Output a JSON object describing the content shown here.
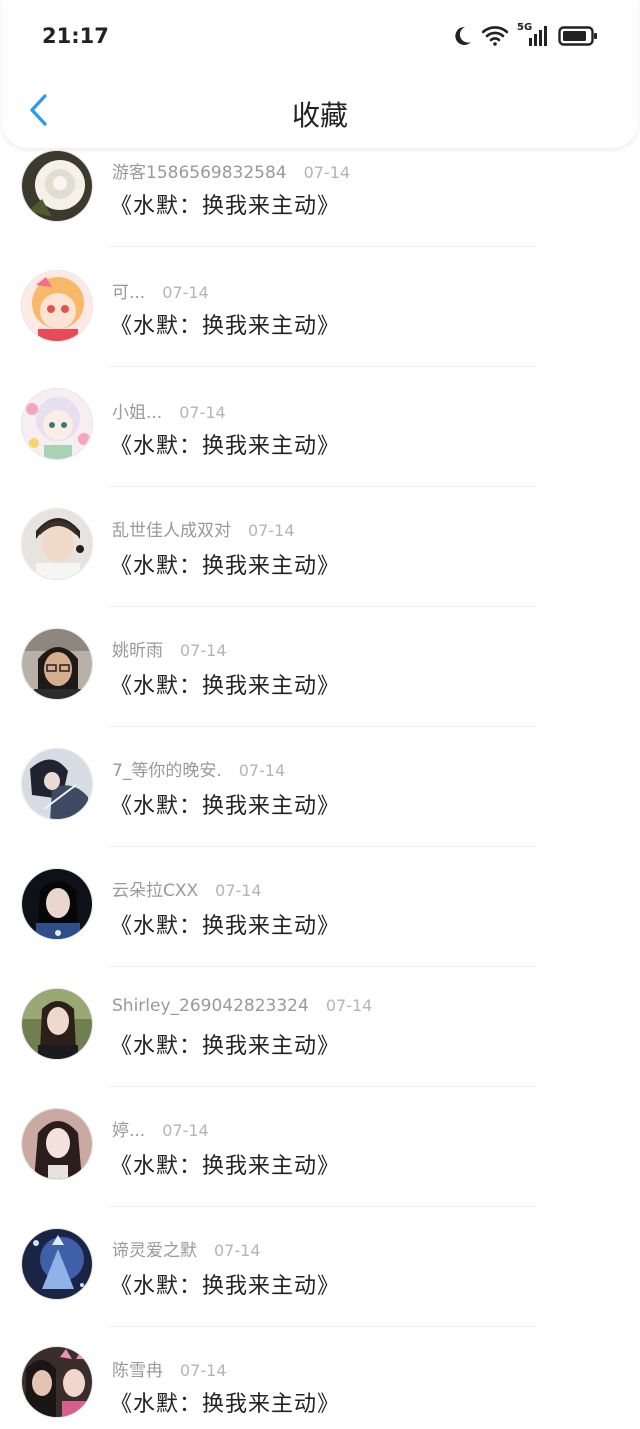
{
  "status_bar": {
    "time": "21:17",
    "icons": [
      "moon-icon",
      "wifi-icon",
      "5g-signal-icon",
      "battery-icon"
    ],
    "network_label": "5G"
  },
  "nav": {
    "back_icon": "chevron-left-icon",
    "title": "收藏",
    "accent_color": "#2f9bf0"
  },
  "favorites": [
    {
      "nickname": "游客1586569832584",
      "date": "07-14",
      "title": "《水默：换我来主动》",
      "avatar": "white-rose"
    },
    {
      "nickname": "可...",
      "date": "07-14",
      "title": "《水默：换我来主动》",
      "avatar": "anime-girl-pink"
    },
    {
      "nickname": "小姐...",
      "date": "07-14",
      "title": "《水默：换我来主动》",
      "avatar": "doll-girl-flowers"
    },
    {
      "nickname": "乱世佳人成双对",
      "date": "07-14",
      "title": "《水默：换我来主动》",
      "avatar": "young-man"
    },
    {
      "nickname": "姚昕雨",
      "date": "07-14",
      "title": "《水默：换我来主动》",
      "avatar": "girl-glasses"
    },
    {
      "nickname": "7_等你的晚安.",
      "date": "07-14",
      "title": "《水默：换我来主动》",
      "avatar": "embracing-couple"
    },
    {
      "nickname": "云朵拉CXX",
      "date": "07-14",
      "title": "《水默：换我来主动》",
      "avatar": "girl-dark"
    },
    {
      "nickname": "Shirley_269042823324",
      "date": "07-14",
      "title": "《水默：换我来主动》",
      "avatar": "girl-outdoor"
    },
    {
      "nickname": "婷...",
      "date": "07-14",
      "title": "《水默：换我来主动》",
      "avatar": "girl-long-hair"
    },
    {
      "nickname": "谛灵爱之默",
      "date": "07-14",
      "title": "《水默：换我来主动》",
      "avatar": "fantasy-art"
    },
    {
      "nickname": "陈雪冉",
      "date": "07-14",
      "title": "《水默：换我来主动》",
      "avatar": "couple-photo"
    }
  ]
}
